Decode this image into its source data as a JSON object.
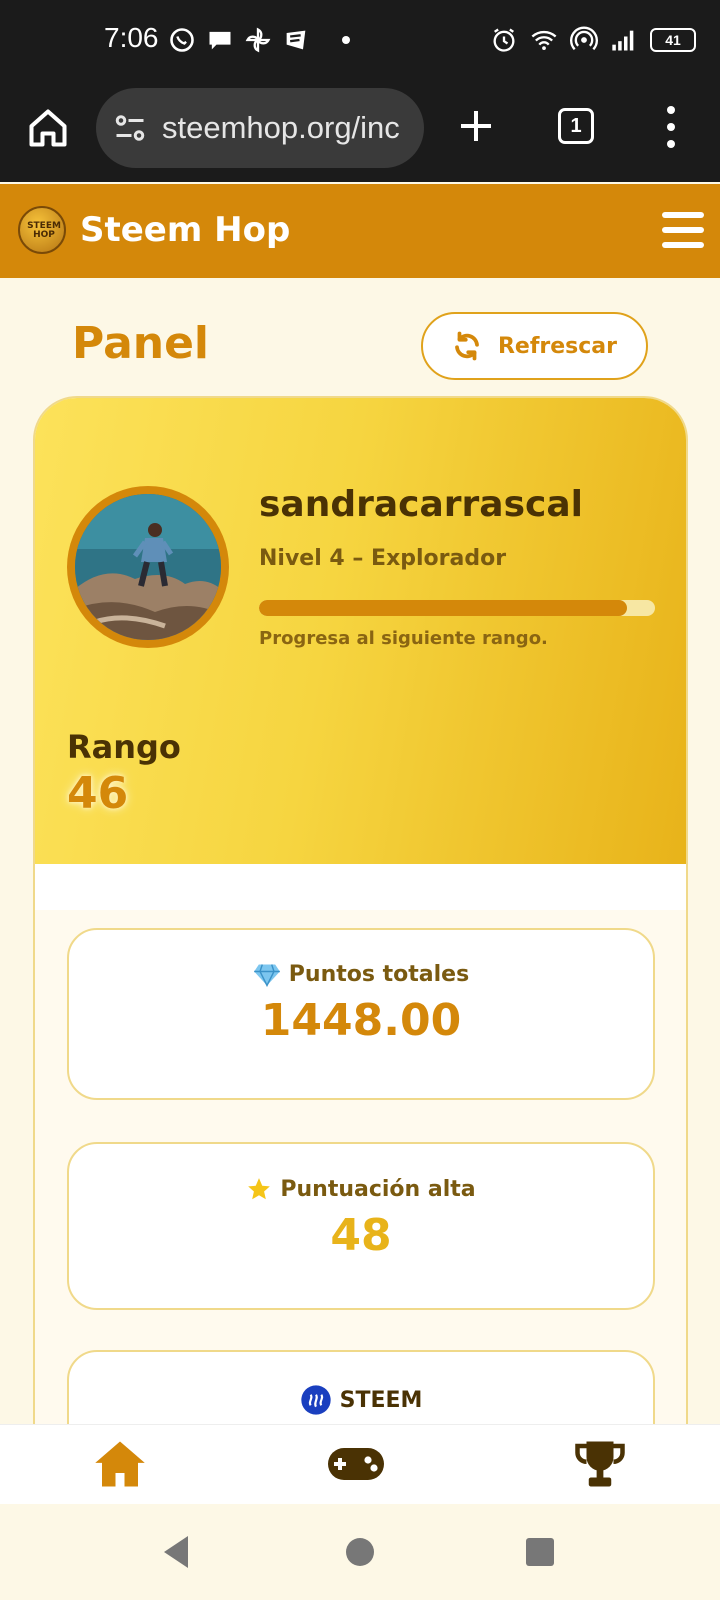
{
  "status_bar": {
    "time": "7:06",
    "battery": "41"
  },
  "browser": {
    "url": "steemhop.org/inc",
    "tab_count": "1"
  },
  "app": {
    "brand": "Steem Hop",
    "logo_text": "STEEM HOP"
  },
  "page": {
    "title": "Panel",
    "refresh_label": "Refrescar"
  },
  "profile": {
    "username": "sandracarrascal",
    "level": "Nivel 4 – Explorador",
    "progress_fraction": 0.93,
    "progress_note": "Progresa al siguiente rango.",
    "rank_label": "Rango",
    "rank_value": "46"
  },
  "stats": {
    "total_points": {
      "icon": "gem-icon",
      "label": "Puntos totales",
      "value": "1448.00",
      "color": "#d4880a"
    },
    "high_score": {
      "icon": "star-icon",
      "label": "Puntuación alta",
      "value": "48",
      "color": "#e8b31a"
    },
    "steem": {
      "icon": "steem-icon",
      "label": "STEEM"
    }
  },
  "bottom_nav": {
    "items": [
      "home-icon",
      "gamepad-icon",
      "trophy-icon"
    ]
  },
  "colors": {
    "accent": "#d4880a",
    "header": "#d4880a",
    "card_gold": "#f6d540"
  }
}
